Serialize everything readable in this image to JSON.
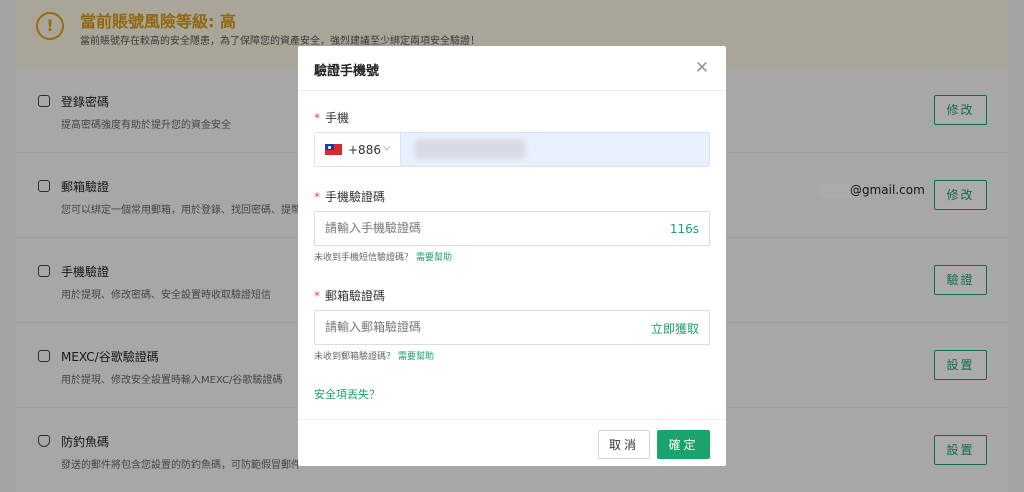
{
  "risk": {
    "icon": "exclamation-circle-icon",
    "icon_glyph": "!",
    "title": "當前賬號風險等級: 高",
    "description": "當前賬號存在較高的安全隱患，為了保障您的資產安全，強烈建議至少綁定兩項安全驗證！"
  },
  "security_items": [
    {
      "icon": "lock-icon",
      "title": "登錄密碼",
      "description": "提高密碼強度有助於提升您的資金安全",
      "value": "",
      "action": "修改"
    },
    {
      "icon": "mail-icon",
      "title": "郵箱驗證",
      "description": "您可以綁定一個常用郵箱，用於登錄、找回密碼、提幣",
      "value": "@gmail.com",
      "action": "修改"
    },
    {
      "icon": "phone-icon",
      "title": "手機驗證",
      "description": "用於提現、修改密碼、安全設置時收取驗證短信",
      "value": "",
      "action": "驗證"
    },
    {
      "icon": "key-icon",
      "title": "MEXC/谷歌驗證碼",
      "description": "用於提現、修改安全設置時輸入MEXC/谷歌驗證碼",
      "value": "",
      "action": "設置"
    },
    {
      "icon": "shield-icon",
      "title": "防釣魚碼",
      "description": "發送的郵件將包含您設置的防釣魚碼，可防範假冒郵件",
      "value": "",
      "action": "設置"
    }
  ],
  "modal": {
    "title": "驗證手機號",
    "close_glyph": "✕",
    "phone": {
      "required_mark": "*",
      "label": "手機",
      "country_code": "+886",
      "chevron": "⌵",
      "flag": "taiwan-flag-icon"
    },
    "sms_code": {
      "required_mark": "*",
      "label": "手機驗證碼",
      "placeholder": "請輸入手機驗證碼",
      "countdown": "116s",
      "help_text": "未收到手機短信驗證碼？",
      "help_link": "需要幫助"
    },
    "email_code": {
      "required_mark": "*",
      "label": "郵箱驗證碼",
      "placeholder": "請輸入郵箱驗證碼",
      "get_code": "立即獲取",
      "help_text": "未收到郵箱驗證碼？",
      "help_link": "需要幫助"
    },
    "lost_link": "安全項丟失？",
    "cancel": "取消",
    "confirm": "確定"
  },
  "colors": {
    "accent": "#1aa36b",
    "warning": "#d99a1a",
    "required": "#e54b4b"
  }
}
